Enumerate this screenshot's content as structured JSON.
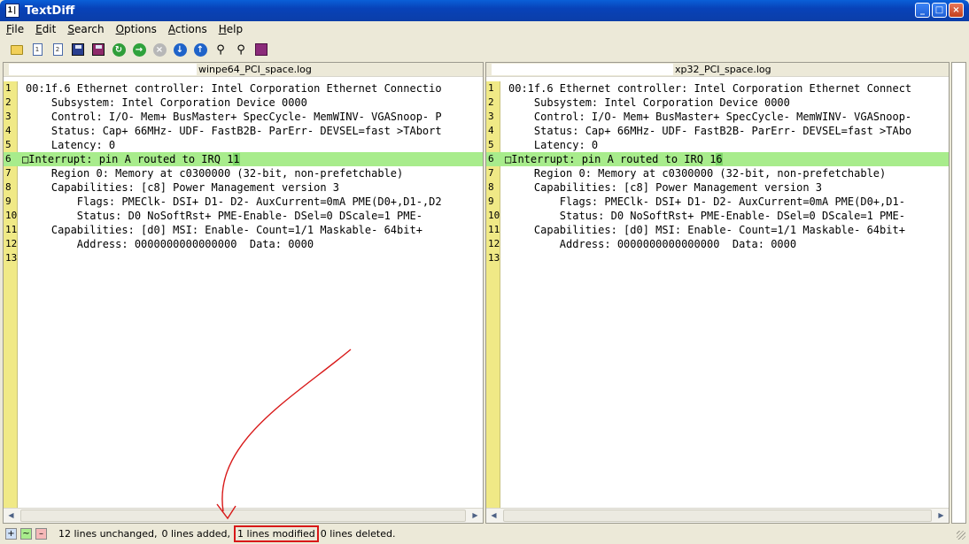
{
  "window": {
    "title": "TextDiff",
    "app_icon_text": "1|",
    "controls": {
      "minimize": "_",
      "maximize": "□",
      "close": "×"
    }
  },
  "menu": [
    {
      "label": "File",
      "accel": "F",
      "rest": "ile"
    },
    {
      "label": "Edit",
      "accel": "E",
      "rest": "dit"
    },
    {
      "label": "Search",
      "accel": "S",
      "rest": "earch"
    },
    {
      "label": "Options",
      "accel": "O",
      "rest": "ptions"
    },
    {
      "label": "Actions",
      "accel": "A",
      "rest": "ctions"
    },
    {
      "label": "Help",
      "accel": "H",
      "rest": "elp"
    }
  ],
  "toolbar_icons": [
    "open-folder-icon",
    "new-document-1-icon",
    "new-document-2-icon",
    "save-icon",
    "save-as-icon",
    "refresh-icon",
    "next-green-icon",
    "stop-grey-icon",
    "down-blue-icon",
    "up-blue-icon",
    "find-binoculars-icon",
    "find-replace-binoculars-icon",
    "help-book-icon"
  ],
  "left": {
    "filename": "winpe64_PCI_space.log",
    "lines": [
      "00:1f.6 Ethernet controller: Intel Corporation Ethernet Connectio",
      "    Subsystem: Intel Corporation Device 0000",
      "    Control: I/O- Mem+ BusMaster+ SpecCycle- MemWINV- VGASnoop- P",
      "    Status: Cap+ 66MHz- UDF- FastB2B- ParErr- DEVSEL=fast >TAbort",
      "    Latency: 0",
      "Interrupt: pin A routed to IRQ 11",
      "    Region 0: Memory at c0300000 (32-bit, non-prefetchable)",
      "    Capabilities: [c8] Power Management version 3",
      "        Flags: PMEClk- DSI+ D1- D2- AuxCurrent=0mA PME(D0+,D1-,D2",
      "        Status: D0 NoSoftRst+ PME-Enable- DSel=0 DScale=1 PME-",
      "    Capabilities: [d0] MSI: Enable- Count=1/1 Maskable- 64bit+",
      "        Address: 0000000000000000  Data: 0000",
      ""
    ]
  },
  "right": {
    "filename": "xp32_PCI_space.log",
    "lines": [
      "00:1f.6 Ethernet controller: Intel Corporation Ethernet Connect",
      "    Subsystem: Intel Corporation Device 0000",
      "    Control: I/O- Mem+ BusMaster+ SpecCycle- MemWINV- VGASnoop-",
      "    Status: Cap+ 66MHz- UDF- FastB2B- ParErr- DEVSEL=fast >TAbo",
      "    Latency: 0",
      "Interrupt: pin A routed to IRQ 16",
      "    Region 0: Memory at c0300000 (32-bit, non-prefetchable)",
      "    Capabilities: [c8] Power Management version 3",
      "        Flags: PMEClk- DSI+ D1- D2- AuxCurrent=0mA PME(D0+,D1-",
      "        Status: D0 NoSoftRst+ PME-Enable- DSel=0 DScale=1 PME-",
      "    Capabilities: [d0] MSI: Enable- Count=1/1 Maskable- 64bit+",
      "        Address: 0000000000000000  Data: 0000",
      ""
    ]
  },
  "modified_line_index": 5,
  "modified_prefix": "Interrupt: pin A routed to IRQ 1",
  "left_modified_char": "1",
  "right_modified_char": "6",
  "modified_marker": "□",
  "status": {
    "legend_added": "+",
    "legend_modified": "~",
    "legend_deleted": "–",
    "unchanged": "12 lines unchanged,",
    "added": "0 lines added,",
    "modified": "1 lines modified",
    "deleted": "0 lines deleted."
  },
  "colors": {
    "modified_bg": "#a8ec8c",
    "modified_char": "#7fd66a",
    "gutter": "#f0e986",
    "annotation": "#d81818"
  }
}
